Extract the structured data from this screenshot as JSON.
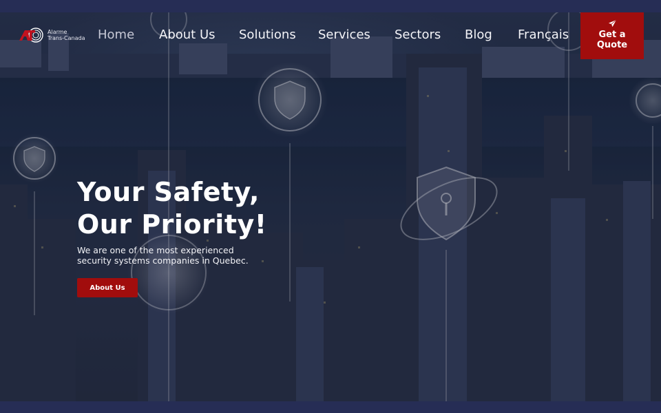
{
  "brand": {
    "logo_mark": "ATC",
    "line1": "Alarme",
    "line2": "Trans-Canada",
    "accent_color": "#a10d0d"
  },
  "nav": {
    "items": [
      {
        "label": "Home",
        "active": true
      },
      {
        "label": "About Us",
        "active": false
      },
      {
        "label": "Solutions",
        "active": false
      },
      {
        "label": "Services",
        "active": false
      },
      {
        "label": "Sectors",
        "active": false
      },
      {
        "label": "Blog",
        "active": false
      },
      {
        "label": "Français",
        "active": false
      }
    ],
    "cta": {
      "line1": "Get a",
      "line2": "Quote",
      "icon": "paper-plane-icon"
    }
  },
  "hero": {
    "headline_line1": "Your Safety,",
    "headline_line2": "Our Priority!",
    "subtext": "We are one of the most experienced security systems companies in Quebec.",
    "button_label": "About Us",
    "background": "night-city-skyline-with-security-shield-icons"
  },
  "colors": {
    "frame": "#262d55",
    "button": "#a10d0d"
  }
}
